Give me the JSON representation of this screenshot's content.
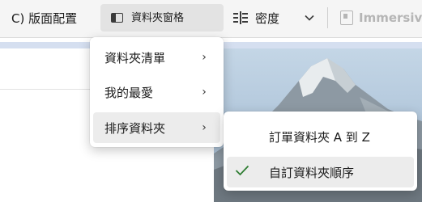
{
  "ribbon": {
    "layout_label": "C) 版面配置",
    "pane_label": "資料夾窗格",
    "density_label": "密度",
    "immersive_label": "Immersive"
  },
  "folder_pane_menu": {
    "items": [
      {
        "label": "資料夾清單",
        "icon": "chevron-right-icon"
      },
      {
        "label": "我的最愛",
        "icon": "chevron-right-icon"
      },
      {
        "label": "排序資料夾",
        "icon": "chevron-right-icon",
        "active": true
      }
    ]
  },
  "sort_submenu": {
    "items": [
      {
        "label": "訂單資料夾 A 到 Z",
        "checked": false
      },
      {
        "label": "自訂資料夾順序",
        "checked": true,
        "check_icon": "checkmark-icon"
      }
    ]
  },
  "colors": {
    "accent_check": "#2e7d32",
    "selected_bg": "#ececec",
    "ribbon_bg": "#f5f5f5"
  }
}
